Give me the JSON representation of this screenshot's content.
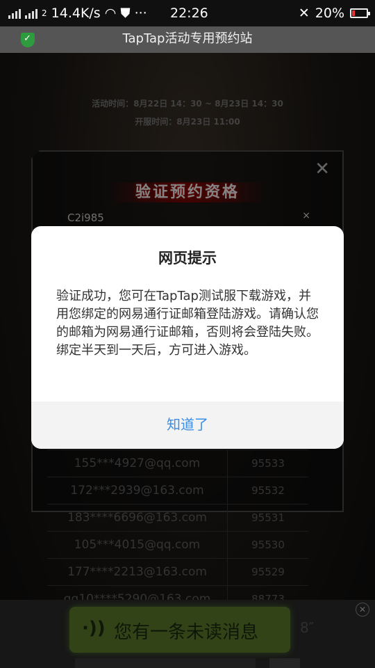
{
  "status_bar": {
    "network_speed": "14.4K/s",
    "network_type": "2",
    "overflow": "···",
    "time": "22:26",
    "battery_percent": "20%",
    "icons": [
      "signal-icon",
      "wifi-icon",
      "data-saver-icon",
      "mute-icon",
      "battery-icon"
    ]
  },
  "browser": {
    "title": "TapTap活动专用预约站",
    "security_icon": "shield-check-icon"
  },
  "page": {
    "activity_time": "活动时间：8月22日 14：30 ~ 8月23日 14：30",
    "open_time": "开服时间：8月23日 11:00",
    "panel": {
      "heading": "验证预约资格",
      "code_value": "C2i985",
      "clear_label": "×",
      "close_label": "✕"
    },
    "table": {
      "rows": [
        {
          "account": "155***4927@qq.com",
          "number": "95533"
        },
        {
          "account": "172***2939@163.com",
          "number": "95532"
        },
        {
          "account": "183****6696@163.com",
          "number": "95531"
        },
        {
          "account": "105***4015@qq.com",
          "number": "95530"
        },
        {
          "account": "177****2213@163.com",
          "number": "95529"
        },
        {
          "account": "qq10****5290@163.com",
          "number": "88773"
        }
      ]
    }
  },
  "toast": {
    "message": "您有一条未读消息",
    "timer": "8″",
    "close_label": "✕"
  },
  "dialog": {
    "title": "网页提示",
    "body": "验证成功，您可在TapTap测试服下载游戏，并用您绑定的网易通行证邮箱登陆游戏。请确认您的邮箱为网易通行证邮箱，否则将会登陆失败。绑定半天到一天后，方可进入游戏。",
    "ok_label": "知道了"
  },
  "colors": {
    "accent": "#3a8ee6",
    "shield": "#2e9b3e",
    "toast": "#5c7a2c",
    "battery_low": "#e33333"
  }
}
